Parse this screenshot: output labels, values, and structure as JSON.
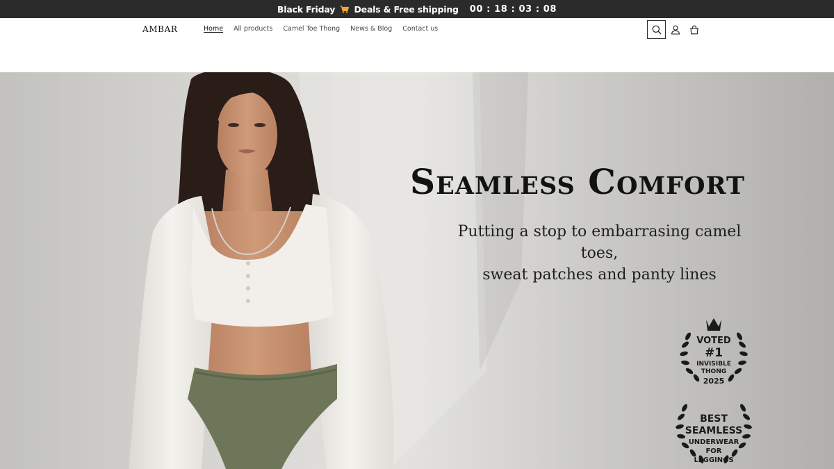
{
  "announcement": {
    "text_before": "Black Friday",
    "text_after": "Deals & Free shipping",
    "countdown": "00 : 18 : 03 : 08"
  },
  "header": {
    "logo": "AMBAR",
    "nav": [
      {
        "label": "Home",
        "active": true
      },
      {
        "label": "All products"
      },
      {
        "label": "Camel Toe Thong"
      },
      {
        "label": "News & Blog"
      },
      {
        "label": "Contact us"
      }
    ],
    "icons": [
      "search-icon",
      "account-icon",
      "cart-icon"
    ]
  },
  "hero": {
    "title": "Seamless Comfort",
    "subtitle_line1": "Putting a stop to embarrasing camel toes,",
    "subtitle_line2": "sweat patches and panty lines",
    "badge1": {
      "line1": "VOTED",
      "line2": "#1",
      "line3": "INVISIBLE",
      "line4": "THONG",
      "line5": "2025"
    },
    "badge2": {
      "line1": "BEST",
      "line2": "SEAMLESS",
      "line3": "UNDERWEAR",
      "line4": "FOR",
      "line5": "LEGGINGS"
    }
  },
  "colors": {
    "announcement_bg": "#2b2b2b",
    "text": "#121212",
    "hero_bg": "#dddcd8",
    "top_white": "#f3f1ee",
    "briefs_green": "#6d7658"
  }
}
